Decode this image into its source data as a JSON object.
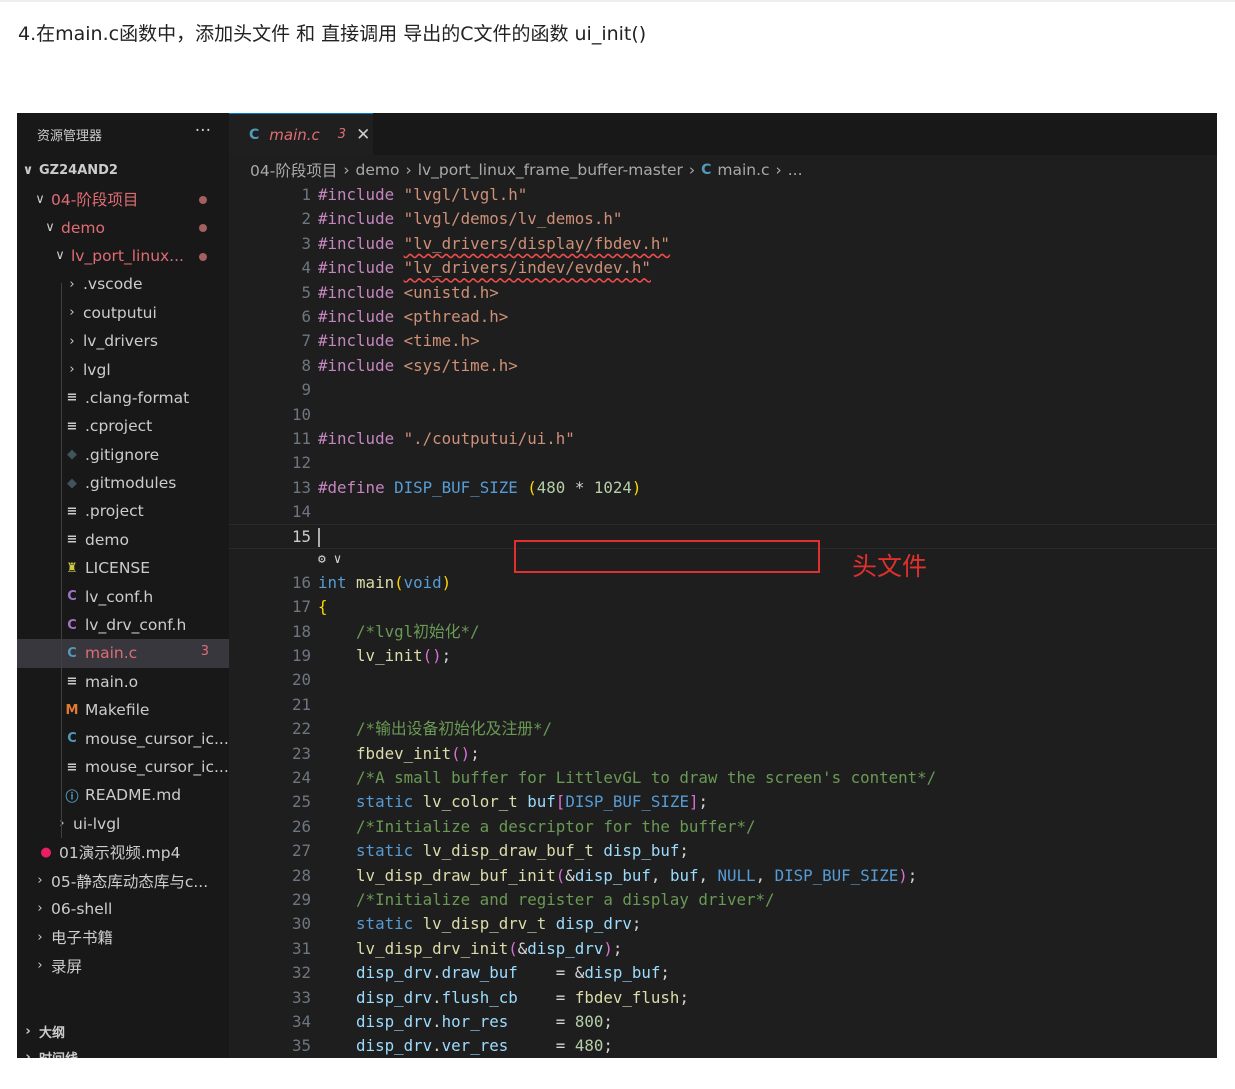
{
  "heading": "4.在main.c函数中，添加头文件 和 直接调用 导出的C文件的函数 ui_init()",
  "sidebar": {
    "title": "资源管理器",
    "more": "···",
    "workspace": "GZ24AND2",
    "items": [
      {
        "label": "04-阶段项目",
        "chev": "∨",
        "icon": "",
        "color": "#e06c75",
        "indent": 16,
        "dot": true
      },
      {
        "label": "demo",
        "chev": "∨",
        "icon": "",
        "color": "#e06c75",
        "indent": 26,
        "dot": true
      },
      {
        "label": "lv_port_linux...",
        "chev": "∨",
        "icon": "",
        "color": "#e06c75",
        "indent": 36,
        "dot": true
      },
      {
        "label": ".vscode",
        "chev": "›",
        "icon": "",
        "color": "#cccccc",
        "indent": 48
      },
      {
        "label": "coutputui",
        "chev": "›",
        "icon": "",
        "color": "#cccccc",
        "indent": 48
      },
      {
        "label": "lv_drivers",
        "chev": "›",
        "icon": "",
        "color": "#cccccc",
        "indent": 48
      },
      {
        "label": "lvgl",
        "chev": "›",
        "icon": "",
        "color": "#cccccc",
        "indent": 48
      },
      {
        "label": ".clang-format",
        "chev": "",
        "icon": "≡",
        "iconColor": "#cccccc",
        "color": "#cccccc",
        "indent": 48
      },
      {
        "label": ".cproject",
        "chev": "",
        "icon": "≡",
        "iconColor": "#cccccc",
        "color": "#cccccc",
        "indent": 48
      },
      {
        "label": ".gitignore",
        "chev": "",
        "icon": "◆",
        "iconColor": "#41535b",
        "color": "#cccccc",
        "indent": 48
      },
      {
        "label": ".gitmodules",
        "chev": "",
        "icon": "◆",
        "iconColor": "#41535b",
        "color": "#cccccc",
        "indent": 48
      },
      {
        "label": ".project",
        "chev": "",
        "icon": "≡",
        "iconColor": "#cccccc",
        "color": "#cccccc",
        "indent": 48
      },
      {
        "label": "demo",
        "chev": "",
        "icon": "≡",
        "iconColor": "#cccccc",
        "color": "#cccccc",
        "indent": 48
      },
      {
        "label": "LICENSE",
        "chev": "",
        "icon": "♜",
        "iconColor": "#cbcb41",
        "color": "#cccccc",
        "indent": 48
      },
      {
        "label": "lv_conf.h",
        "chev": "",
        "icon": "C",
        "iconColor": "#a074c4",
        "color": "#cccccc",
        "indent": 48
      },
      {
        "label": "lv_drv_conf.h",
        "chev": "",
        "icon": "C",
        "iconColor": "#a074c4",
        "color": "#cccccc",
        "indent": 48
      },
      {
        "label": "main.c",
        "chev": "",
        "icon": "C",
        "iconColor": "#519aba",
        "color": "#e06c75",
        "indent": 48,
        "selected": true,
        "badge": "3"
      },
      {
        "label": "main.o",
        "chev": "",
        "icon": "≡",
        "iconColor": "#cccccc",
        "color": "#cccccc",
        "indent": 48
      },
      {
        "label": "Makefile",
        "chev": "",
        "icon": "M",
        "iconColor": "#e37933",
        "color": "#cccccc",
        "indent": 48
      },
      {
        "label": "mouse_cursor_ic...",
        "chev": "",
        "icon": "C",
        "iconColor": "#519aba",
        "color": "#cccccc",
        "indent": 48
      },
      {
        "label": "mouse_cursor_ic...",
        "chev": "",
        "icon": "≡",
        "iconColor": "#cccccc",
        "color": "#cccccc",
        "indent": 48
      },
      {
        "label": "README.md",
        "chev": "",
        "icon": "ⓘ",
        "iconColor": "#519aba",
        "color": "#cccccc",
        "indent": 48
      },
      {
        "label": "ui-lvgl",
        "chev": "›",
        "icon": "",
        "color": "#cccccc",
        "indent": 38
      },
      {
        "label": "01演示视频.mp4",
        "chev": "",
        "icon": "●",
        "iconColor": "#e91e63",
        "color": "#cccccc",
        "indent": 22
      },
      {
        "label": "05-静态库动态库与c...",
        "chev": "›",
        "icon": "",
        "color": "#cccccc",
        "indent": 16
      },
      {
        "label": "06-shell",
        "chev": "›",
        "icon": "",
        "color": "#cccccc",
        "indent": 16
      },
      {
        "label": "电子书籍",
        "chev": "›",
        "icon": "",
        "color": "#cccccc",
        "indent": 16
      },
      {
        "label": "录屏",
        "chev": "›",
        "icon": "",
        "color": "#cccccc",
        "indent": 16
      }
    ],
    "outline": "大纲",
    "timeline": "时间线"
  },
  "tab": {
    "icon": "C",
    "name": "main.c",
    "errors": "3",
    "close": "✕"
  },
  "breadcrumb": [
    "04-阶段项目",
    "›",
    "demo",
    "›",
    "lv_port_linux_frame_buffer-master",
    "›",
    "C",
    "main.c",
    "›",
    "..."
  ],
  "code": [
    {
      "n": "1",
      "t": [
        [
          "#include ",
          "kw"
        ],
        [
          "\"lvgl/lvgl.h\"",
          "st"
        ]
      ]
    },
    {
      "n": "2",
      "t": [
        [
          "#include ",
          "kw"
        ],
        [
          "\"lvgl/demos/lv_demos.h\"",
          "st"
        ]
      ]
    },
    {
      "n": "3",
      "t": [
        [
          "#include ",
          "kw"
        ],
        [
          "\"lv_drivers/display/fbdev.h\"",
          "st squig"
        ]
      ]
    },
    {
      "n": "4",
      "t": [
        [
          "#include ",
          "kw"
        ],
        [
          "\"lv_drivers/indev/evdev.h\"",
          "st squig"
        ]
      ]
    },
    {
      "n": "5",
      "t": [
        [
          "#include ",
          "kw"
        ],
        [
          "<unistd.h>",
          "st"
        ]
      ]
    },
    {
      "n": "6",
      "t": [
        [
          "#include ",
          "kw"
        ],
        [
          "<pthread.h>",
          "st"
        ]
      ]
    },
    {
      "n": "7",
      "t": [
        [
          "#include ",
          "kw"
        ],
        [
          "<time.h>",
          "st"
        ]
      ]
    },
    {
      "n": "8",
      "t": [
        [
          "#include ",
          "kw"
        ],
        [
          "<sys/time.h>",
          "st"
        ]
      ]
    },
    {
      "n": "9",
      "t": []
    },
    {
      "n": "10",
      "t": []
    },
    {
      "n": "11",
      "t": [
        [
          "#include ",
          "kw"
        ],
        [
          "\"./coutputui/ui.h\"",
          "st"
        ]
      ]
    },
    {
      "n": "12",
      "t": []
    },
    {
      "n": "13",
      "t": [
        [
          "#define ",
          "kw"
        ],
        [
          "DISP_BUF_SIZE ",
          "ma"
        ],
        [
          "(",
          "br"
        ],
        [
          "480",
          "nu"
        ],
        [
          " * ",
          "pl"
        ],
        [
          "1024",
          "nu"
        ],
        [
          ")",
          "br"
        ]
      ]
    },
    {
      "n": "14",
      "t": []
    },
    {
      "n": "15",
      "t": [],
      "current": true
    },
    {
      "lens": true,
      "t": [
        [
          "⚙ ∨",
          "pl"
        ]
      ]
    },
    {
      "n": "16",
      "t": [
        [
          "int ",
          "ty"
        ],
        [
          "main",
          "fn"
        ],
        [
          "(",
          "br"
        ],
        [
          "void",
          "ty"
        ],
        [
          ")",
          "br"
        ]
      ]
    },
    {
      "n": "17",
      "t": [
        [
          "{",
          "br"
        ]
      ]
    },
    {
      "n": "18",
      "t": [
        [
          "    /*lvgl初始化*/",
          "cm"
        ]
      ]
    },
    {
      "n": "19",
      "t": [
        [
          "    ",
          "pl"
        ],
        [
          "lv_init",
          "fn"
        ],
        [
          "()",
          "br2"
        ],
        [
          ";",
          "pl"
        ]
      ]
    },
    {
      "n": "20",
      "t": []
    },
    {
      "n": "21",
      "t": []
    },
    {
      "n": "22",
      "t": [
        [
          "    /*输出设备初始化及注册*/",
          "cm"
        ]
      ]
    },
    {
      "n": "23",
      "t": [
        [
          "    ",
          "pl"
        ],
        [
          "fbdev_init",
          "fn"
        ],
        [
          "()",
          "br2"
        ],
        [
          ";",
          "pl"
        ]
      ]
    },
    {
      "n": "24",
      "t": [
        [
          "    /*A small buffer for LittlevGL to draw the screen's content*/",
          "cm"
        ]
      ]
    },
    {
      "n": "25",
      "t": [
        [
          "    ",
          "pl"
        ],
        [
          "static ",
          "ty"
        ],
        [
          "lv_color_t ",
          "fn"
        ],
        [
          "buf",
          "va"
        ],
        [
          "[",
          "br2"
        ],
        [
          "DISP_BUF_SIZE",
          "ma"
        ],
        [
          "]",
          "br2"
        ],
        [
          ";",
          "pl"
        ]
      ]
    },
    {
      "n": "26",
      "t": [
        [
          "    /*Initialize a descriptor for the buffer*/",
          "cm"
        ]
      ]
    },
    {
      "n": "27",
      "t": [
        [
          "    ",
          "pl"
        ],
        [
          "static ",
          "ty"
        ],
        [
          "lv_disp_draw_buf_t ",
          "fn"
        ],
        [
          "disp_buf",
          "va"
        ],
        [
          ";",
          "pl"
        ]
      ]
    },
    {
      "n": "28",
      "t": [
        [
          "    ",
          "pl"
        ],
        [
          "lv_disp_draw_buf_init",
          "fn"
        ],
        [
          "(",
          "br2"
        ],
        [
          "&",
          "pl"
        ],
        [
          "disp_buf",
          "va"
        ],
        [
          ", ",
          "pl"
        ],
        [
          "buf",
          "va"
        ],
        [
          ", ",
          "pl"
        ],
        [
          "NULL",
          "ma"
        ],
        [
          ", ",
          "pl"
        ],
        [
          "DISP_BUF_SIZE",
          "ma"
        ],
        [
          ")",
          "br2"
        ],
        [
          ";",
          "pl"
        ]
      ]
    },
    {
      "n": "29",
      "t": [
        [
          "    /*Initialize and register a display driver*/",
          "cm"
        ]
      ]
    },
    {
      "n": "30",
      "t": [
        [
          "    ",
          "pl"
        ],
        [
          "static ",
          "ty"
        ],
        [
          "lv_disp_drv_t ",
          "fn"
        ],
        [
          "disp_drv",
          "va"
        ],
        [
          ";",
          "pl"
        ]
      ]
    },
    {
      "n": "31",
      "t": [
        [
          "    ",
          "pl"
        ],
        [
          "lv_disp_drv_init",
          "fn"
        ],
        [
          "(",
          "br2"
        ],
        [
          "&",
          "pl"
        ],
        [
          "disp_drv",
          "va"
        ],
        [
          ")",
          "br2"
        ],
        [
          ";",
          "pl"
        ]
      ]
    },
    {
      "n": "32",
      "t": [
        [
          "    ",
          "pl"
        ],
        [
          "disp_drv",
          "va"
        ],
        [
          ".",
          "pl"
        ],
        [
          "draw_buf",
          "va"
        ],
        [
          "    = &",
          "pl"
        ],
        [
          "disp_buf",
          "va"
        ],
        [
          ";",
          "pl"
        ]
      ]
    },
    {
      "n": "33",
      "t": [
        [
          "    ",
          "pl"
        ],
        [
          "disp_drv",
          "va"
        ],
        [
          ".",
          "pl"
        ],
        [
          "flush_cb",
          "va"
        ],
        [
          "    = ",
          "pl"
        ],
        [
          "fbdev_flush",
          "fn"
        ],
        [
          ";",
          "pl"
        ]
      ]
    },
    {
      "n": "34",
      "t": [
        [
          "    ",
          "pl"
        ],
        [
          "disp_drv",
          "va"
        ],
        [
          ".",
          "pl"
        ],
        [
          "hor_res",
          "va"
        ],
        [
          "     = ",
          "pl"
        ],
        [
          "800",
          "nu"
        ],
        [
          ";",
          "pl"
        ]
      ]
    },
    {
      "n": "35",
      "t": [
        [
          "    ",
          "pl"
        ],
        [
          "disp_drv",
          "va"
        ],
        [
          ".",
          "pl"
        ],
        [
          "ver_res",
          "va"
        ],
        [
          "     = ",
          "pl"
        ],
        [
          "480",
          "nu"
        ],
        [
          ";",
          "pl"
        ]
      ]
    }
  ],
  "annotation": "头文件"
}
